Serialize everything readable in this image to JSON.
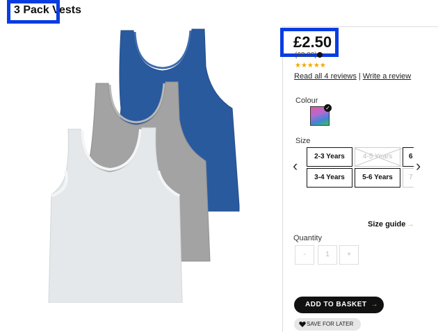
{
  "product": {
    "title": "3 Pack Vests",
    "price": "£2.50",
    "was_price": "(£3.00)",
    "rating_stars": "★★★★★",
    "reviews_link": "Read all 4 reviews",
    "reviews_separator": "|",
    "write_review_link": "Write a review"
  },
  "colour": {
    "label": "Colour",
    "swatch_colors": [
      "#e15aa3",
      "#3f86d6",
      "#3fbf5e"
    ]
  },
  "size": {
    "label": "Size",
    "prev_arrow": "‹",
    "next_arrow": "›",
    "options": [
      {
        "label": "2-3 Years",
        "available": true
      },
      {
        "label": "4-5 Years",
        "available": false
      },
      {
        "label": "6",
        "available": true
      },
      {
        "label": "3-4 Years",
        "available": true
      },
      {
        "label": "5-6 Years",
        "available": true
      },
      {
        "label": "7",
        "available": false
      }
    ],
    "guide_label": "Size guide",
    "guide_arrow": "→"
  },
  "quantity": {
    "label": "Quantity",
    "minus": "-",
    "value": "1",
    "plus": "+"
  },
  "actions": {
    "add_to_basket": "ADD TO BASKET",
    "add_arrow": "→",
    "save_for_later": "SAVE FOR LATER"
  },
  "image": {
    "colors": {
      "blue_vest": "#2a5a9e",
      "grey_vest": "#a3a3a3",
      "white_vest": "#e4e8ea"
    }
  }
}
